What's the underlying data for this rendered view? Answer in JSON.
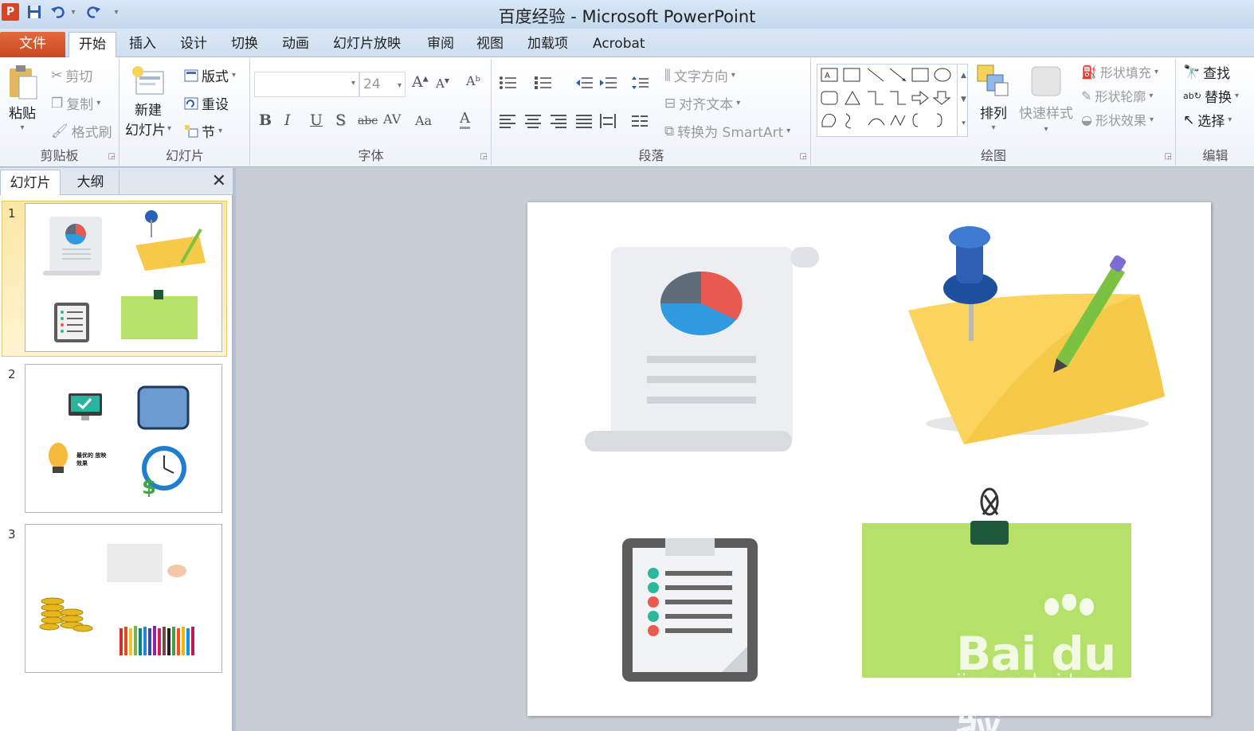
{
  "window": {
    "title": "百度经验 - Microsoft PowerPoint",
    "app_logo": "P"
  },
  "tabs": [
    {
      "label": "文件"
    },
    {
      "label": "开始"
    },
    {
      "label": "插入"
    },
    {
      "label": "设计"
    },
    {
      "label": "切换"
    },
    {
      "label": "动画"
    },
    {
      "label": "幻灯片放映"
    },
    {
      "label": "审阅"
    },
    {
      "label": "视图"
    },
    {
      "label": "加载项"
    },
    {
      "label": "Acrobat"
    }
  ],
  "ribbon": {
    "clipboard": {
      "label": "剪贴板",
      "paste": "粘贴",
      "cut": "剪切",
      "copy": "复制",
      "format_painter": "格式刷"
    },
    "slides": {
      "label": "幻灯片",
      "new_slide_1": "新建",
      "new_slide_2": "幻灯片",
      "layout": "版式",
      "reset": "重设",
      "section": "节"
    },
    "font": {
      "label": "字体",
      "font_name": "",
      "font_size": "24"
    },
    "paragraph": {
      "label": "段落",
      "text_direction": "文字方向",
      "align_text": "对齐文本",
      "smartart": "转换为 SmartArt"
    },
    "drawing": {
      "label": "绘图",
      "arrange": "排列",
      "quick_styles": "快速样式",
      "shape_fill": "形状填充",
      "shape_outline": "形状轮廓",
      "shape_effects": "形状效果"
    },
    "editing": {
      "label": "编辑",
      "find": "查找",
      "replace": "替换",
      "select": "选择"
    }
  },
  "left_panel": {
    "tabs": [
      {
        "label": "幻灯片"
      },
      {
        "label": "大纲"
      }
    ],
    "slides": [
      {
        "number": "1"
      },
      {
        "number": "2"
      },
      {
        "number": "3"
      }
    ],
    "slide2_caption": "最优的 放映效果"
  },
  "watermark": {
    "brand": "Bai du 经验",
    "url": "jingyan.baidu.com"
  },
  "colors": {
    "file_tab": "#d24726",
    "selection": "#fbe6a3",
    "sticky_yellow": "#f7c948",
    "sticky_green": "#b5e06a"
  }
}
